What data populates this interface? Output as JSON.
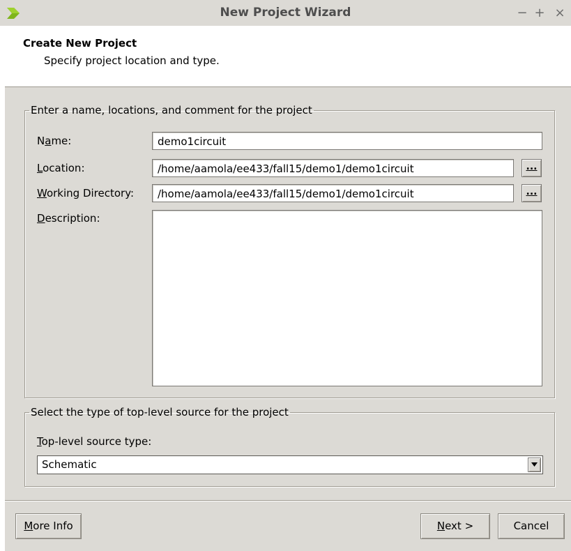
{
  "window": {
    "title": "New Project Wizard",
    "minimize": "−",
    "maximize": "+",
    "close": "×"
  },
  "header": {
    "title": "Create New Project",
    "subtitle": "Specify project location and type."
  },
  "project_group": {
    "legend": "Enter a name, locations, and comment for the project",
    "name_label_pre": "N",
    "name_label_u": "a",
    "name_label_post": "me:",
    "name_value": "demo1circuit",
    "location_label_u": "L",
    "location_label_post": "ocation:",
    "location_value": "/home/aamola/ee433/fall15/demo1/demo1circuit",
    "workdir_label_u": "W",
    "workdir_label_post": "orking Directory:",
    "workdir_value": "/home/aamola/ee433/fall15/demo1/demo1circuit",
    "description_label_u": "D",
    "description_label_post": "escription:",
    "description_value": "",
    "browse_label": "..."
  },
  "source_group": {
    "legend": "Select the type of top-level source for the project",
    "type_label_u": "T",
    "type_label_post": "op-level source type:",
    "selected": "Schematic"
  },
  "footer": {
    "more_info_u": "M",
    "more_info_post": "ore Info",
    "next_u": "N",
    "next_post": "ext >",
    "cancel": "Cancel"
  },
  "colors": {
    "dialog_bg": "#dcdad5",
    "logo": "#7fb51c"
  }
}
